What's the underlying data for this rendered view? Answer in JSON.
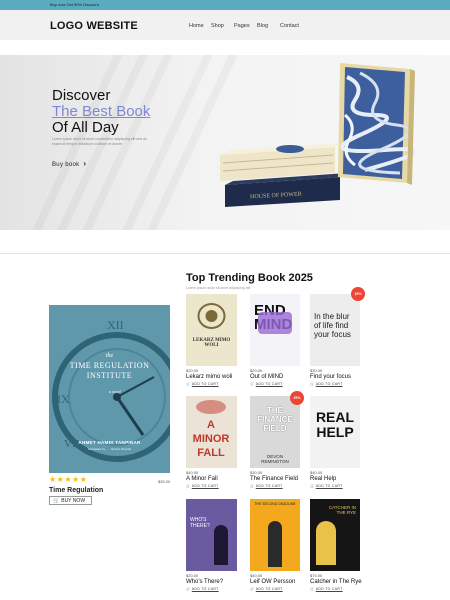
{
  "topbar": {
    "promo": "Buy now Get 50% Discount"
  },
  "header": {
    "logo": "LOGO WEBSITE",
    "nav": [
      "Home",
      "Shop",
      "Pages",
      "Blog",
      "Contact"
    ]
  },
  "hero": {
    "line1": "Discover",
    "line2": "The Best Book",
    "line3": "Of All Day",
    "desc": "Lorem ipsum dolor sit amet consectetur adipiscing elit sed do eiusmod tempor incididunt ut labore et dolore",
    "button": "Buy book",
    "book_title": "HOUSE OF POWER"
  },
  "section": {
    "title": "Top Trending Book 2025",
    "subtitle": "Lorem ipsum dolor sit amet adipiscing elit"
  },
  "featured": {
    "cover_top": "the",
    "cover_title_1": "TIME REGULATION",
    "cover_title_2": "INSTITUTE",
    "cover_novel": "a novel",
    "cover_author": "AHMET HAMDI TANPINAR",
    "cover_translator": "translated by ... · Robert Wendel",
    "stars": "★★★★★",
    "rating": 5,
    "price": "$30.00",
    "name": "Time Regulation",
    "button": "BUY NOW"
  },
  "books": [
    {
      "name": "Lekarz mimo woli",
      "price": "$20.00",
      "cart": "ADD TO CART",
      "cover_text": "LEKARZ MIMO WOLI",
      "badge": ""
    },
    {
      "name": "Out of MIND",
      "price": "$20.00",
      "cart": "ADD TO CART",
      "cover_text": "END MIND",
      "badge": ""
    },
    {
      "name": "Find your focus",
      "price": "$30.00",
      "cart": "ADD TO CART",
      "cover_text": "In the blur of life find your focus",
      "badge": "15%"
    },
    {
      "name": "A Minor Fall",
      "price": "$40.00",
      "cart": "ADD TO CART",
      "cover_text": "A MINOR FALL",
      "badge": ""
    },
    {
      "name": "The Finance Field",
      "price": "$30.00",
      "cart": "ADD TO CART",
      "cover_text": "THE FINANCE FIELD",
      "cover_author": "DEVON REMINGTON",
      "badge": "25%"
    },
    {
      "name": "Real Help",
      "price": "$40.00",
      "cart": "ADD TO CART",
      "cover_text": "REAL HELP",
      "badge": ""
    },
    {
      "name": "Who's There?",
      "price": "$20.00",
      "cart": "ADD TO CART",
      "cover_text": "WHO'S THERE?",
      "badge": ""
    },
    {
      "name": "Leif OW Persson",
      "price": "$40.00",
      "cart": "ADD TO CART",
      "cover_text": "THE SECOND DEADLINE",
      "badge": ""
    },
    {
      "name": "Catcher in The Rye",
      "price": "$70.00",
      "cart": "ADD TO CART",
      "cover_text": "CATCHER IN THE RYE",
      "badge": ""
    }
  ],
  "colors": {
    "topbar": "#5aabbd",
    "accent": "#7f87d6",
    "star": "#f2c200",
    "badge": "#e43"
  }
}
